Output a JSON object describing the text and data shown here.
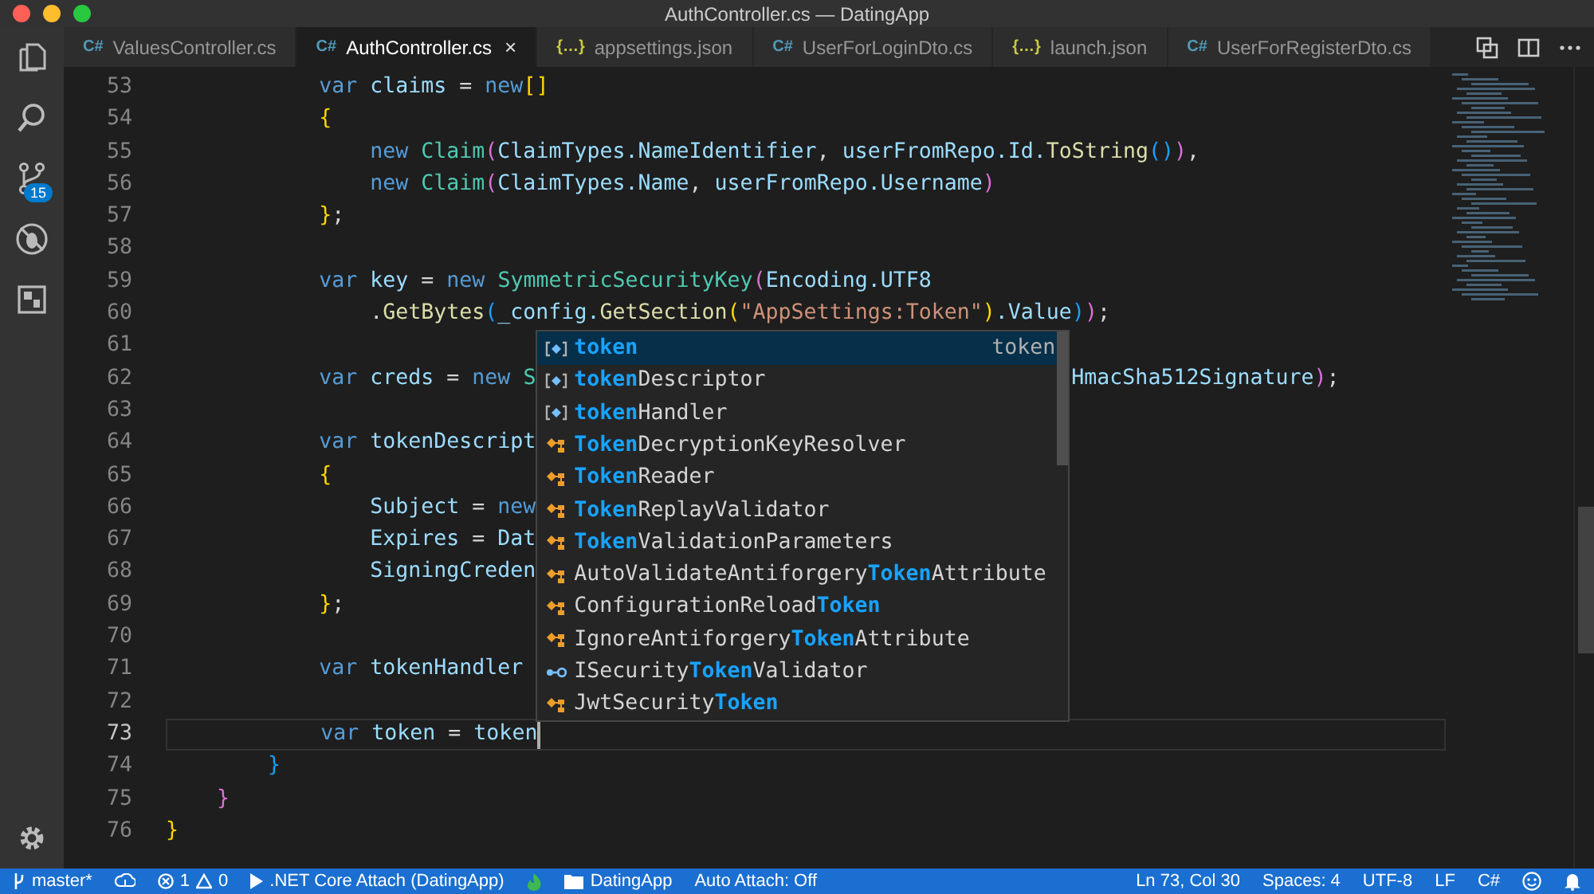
{
  "window": {
    "title": "AuthController.cs — DatingApp"
  },
  "activity_bar": {
    "source_control_badge": "15"
  },
  "tabs": [
    {
      "label": "ValuesController.cs",
      "kind": "csharp",
      "icon": "C#",
      "selected": false
    },
    {
      "label": "AuthController.cs",
      "kind": "csharp",
      "icon": "C#",
      "selected": true,
      "close": "×"
    },
    {
      "label": "appsettings.json",
      "kind": "json",
      "icon": "{…}",
      "selected": false
    },
    {
      "label": "UserForLoginDto.cs",
      "kind": "csharp",
      "icon": "C#",
      "selected": false
    },
    {
      "label": "launch.json",
      "kind": "json",
      "icon": "{…}",
      "selected": false
    },
    {
      "label": "UserForRegisterDto.cs",
      "kind": "csharp",
      "icon": "C#",
      "selected": false
    }
  ],
  "editor": {
    "lines": [
      {
        "number": "53",
        "segments": [
          {
            "text": "            var",
            "kind": "kw"
          },
          {
            "text": " claims",
            "kind": "id"
          },
          {
            "text": " = ",
            "kind": "p"
          },
          {
            "text": "new",
            "kind": "kw"
          },
          {
            "text": "[]",
            "kind": "b1"
          }
        ]
      },
      {
        "number": "54",
        "segments": [
          {
            "text": "            {",
            "kind": "b1"
          }
        ]
      },
      {
        "number": "55",
        "segments": [
          {
            "text": "                new",
            "kind": "kw"
          },
          {
            "text": " Claim",
            "kind": "type"
          },
          {
            "text": "(",
            "kind": "b2"
          },
          {
            "text": "ClaimTypes.NameIdentifier",
            "kind": "id"
          },
          {
            "text": ", ",
            "kind": "p"
          },
          {
            "text": "userFromRepo.Id.",
            "kind": "id"
          },
          {
            "text": "ToString",
            "kind": "fn"
          },
          {
            "text": "()",
            "kind": "b3"
          },
          {
            "text": ")",
            "kind": "b2"
          },
          {
            "text": ",",
            "kind": "p"
          }
        ]
      },
      {
        "number": "56",
        "segments": [
          {
            "text": "                new",
            "kind": "kw"
          },
          {
            "text": " Claim",
            "kind": "type"
          },
          {
            "text": "(",
            "kind": "b2"
          },
          {
            "text": "ClaimTypes.Name",
            "kind": "id"
          },
          {
            "text": ", ",
            "kind": "p"
          },
          {
            "text": "userFromRepo.Username",
            "kind": "id"
          },
          {
            "text": ")",
            "kind": "b2"
          }
        ]
      },
      {
        "number": "57",
        "segments": [
          {
            "text": "            }",
            "kind": "b1"
          },
          {
            "text": ";",
            "kind": "p"
          }
        ]
      },
      {
        "number": "58"
      },
      {
        "number": "59",
        "segments": [
          {
            "text": "            var",
            "kind": "kw"
          },
          {
            "text": " key",
            "kind": "id"
          },
          {
            "text": " = ",
            "kind": "p"
          },
          {
            "text": "new",
            "kind": "kw"
          },
          {
            "text": " SymmetricSecurityKey",
            "kind": "type"
          },
          {
            "text": "(",
            "kind": "b2"
          },
          {
            "text": "Encoding.UTF8",
            "kind": "id"
          }
        ]
      },
      {
        "number": "60",
        "segments": [
          {
            "text": "                .",
            "kind": "p"
          },
          {
            "text": "GetBytes",
            "kind": "fn"
          },
          {
            "text": "(",
            "kind": "b3"
          },
          {
            "text": "_config.",
            "kind": "id"
          },
          {
            "text": "GetSection",
            "kind": "fn"
          },
          {
            "text": "(",
            "kind": "b1"
          },
          {
            "text": "\"AppSettings:Token\"",
            "kind": "str"
          },
          {
            "text": ")",
            "kind": "b1"
          },
          {
            "text": ".Value",
            "kind": "id"
          },
          {
            "text": ")",
            "kind": "b3"
          },
          {
            "text": ")",
            "kind": "b2"
          },
          {
            "text": ";",
            "kind": "p"
          }
        ]
      },
      {
        "number": "61"
      },
      {
        "number": "62",
        "segments": [
          {
            "text": "            var",
            "kind": "kw"
          },
          {
            "text": " creds",
            "kind": "id"
          },
          {
            "text": " = ",
            "kind": "p"
          },
          {
            "text": "new",
            "kind": "kw"
          },
          {
            "text": " S",
            "kind": "type"
          }
        ],
        "trailing": [
          {
            "text": "HmacSha512Signature",
            "kind": "id"
          },
          {
            "text": ")",
            "kind": "b2"
          },
          {
            "text": ";",
            "kind": "p"
          }
        ]
      },
      {
        "number": "63"
      },
      {
        "number": "64",
        "segments": [
          {
            "text": "            var",
            "kind": "kw"
          },
          {
            "text": " tokenDescript",
            "kind": "id"
          }
        ]
      },
      {
        "number": "65",
        "segments": [
          {
            "text": "            {",
            "kind": "b1"
          }
        ]
      },
      {
        "number": "66",
        "segments": [
          {
            "text": "                Subject",
            "kind": "id"
          },
          {
            "text": " = ",
            "kind": "p"
          },
          {
            "text": "new",
            "kind": "kw"
          }
        ]
      },
      {
        "number": "67",
        "segments": [
          {
            "text": "                Expires",
            "kind": "id"
          },
          {
            "text": " = ",
            "kind": "p"
          },
          {
            "text": "Dat",
            "kind": "id"
          }
        ]
      },
      {
        "number": "68",
        "segments": [
          {
            "text": "                SigningCreden",
            "kind": "id"
          }
        ]
      },
      {
        "number": "69",
        "segments": [
          {
            "text": "            }",
            "kind": "b1"
          },
          {
            "text": ";",
            "kind": "p"
          }
        ]
      },
      {
        "number": "70"
      },
      {
        "number": "71",
        "segments": [
          {
            "text": "            var",
            "kind": "kw"
          },
          {
            "text": " tokenHandler",
            "kind": "id"
          }
        ]
      },
      {
        "number": "72"
      },
      {
        "number": "73",
        "current": true,
        "segments": [
          {
            "text": "            var",
            "kind": "kw"
          },
          {
            "text": " token",
            "kind": "id"
          },
          {
            "text": " = ",
            "kind": "p"
          },
          {
            "text": "token",
            "kind": "id"
          }
        ]
      },
      {
        "number": "74",
        "segments": [
          {
            "text": "        }",
            "kind": "b3"
          }
        ]
      },
      {
        "number": "75",
        "segments": [
          {
            "text": "    }",
            "kind": "b2"
          }
        ]
      },
      {
        "number": "76",
        "segments": [
          {
            "text": "}",
            "kind": "b1"
          }
        ]
      }
    ]
  },
  "suggestions": [
    {
      "kind": "variable",
      "parts": [
        {
          "text": "token",
          "match": true
        }
      ],
      "selected": true,
      "detail": "token"
    },
    {
      "kind": "variable",
      "parts": [
        {
          "text": "token",
          "match": true
        },
        {
          "text": "Descriptor",
          "match": false
        }
      ],
      "selected": false
    },
    {
      "kind": "variable",
      "parts": [
        {
          "text": "token",
          "match": true
        },
        {
          "text": "Handler",
          "match": false
        }
      ],
      "selected": false
    },
    {
      "kind": "class",
      "parts": [
        {
          "text": "Token",
          "match": true
        },
        {
          "text": "DecryptionKeyResolver",
          "match": false
        }
      ],
      "selected": false
    },
    {
      "kind": "class",
      "parts": [
        {
          "text": "Token",
          "match": true
        },
        {
          "text": "Reader",
          "match": false
        }
      ],
      "selected": false
    },
    {
      "kind": "class",
      "parts": [
        {
          "text": "Token",
          "match": true
        },
        {
          "text": "ReplayValidator",
          "match": false
        }
      ],
      "selected": false
    },
    {
      "kind": "class",
      "parts": [
        {
          "text": "Token",
          "match": true
        },
        {
          "text": "ValidationParameters",
          "match": false
        }
      ],
      "selected": false
    },
    {
      "kind": "class",
      "parts": [
        {
          "text": "AutoValidateAntiforgery",
          "match": false
        },
        {
          "text": "Token",
          "match": true
        },
        {
          "text": "Attribute",
          "match": false
        }
      ],
      "selected": false
    },
    {
      "kind": "class",
      "parts": [
        {
          "text": "ConfigurationReload",
          "match": false
        },
        {
          "text": "Token",
          "match": true
        }
      ],
      "selected": false
    },
    {
      "kind": "class",
      "parts": [
        {
          "text": "IgnoreAntiforgery",
          "match": false
        },
        {
          "text": "Token",
          "match": true
        },
        {
          "text": "Attribute",
          "match": false
        }
      ],
      "selected": false
    },
    {
      "kind": "interface",
      "parts": [
        {
          "text": "ISecurity",
          "match": false
        },
        {
          "text": "Token",
          "match": true
        },
        {
          "text": "Validator",
          "match": false
        }
      ],
      "selected": false
    },
    {
      "kind": "class",
      "parts": [
        {
          "text": "JwtSecurity",
          "match": false
        },
        {
          "text": "Token",
          "match": true
        }
      ],
      "selected": false
    }
  ],
  "status_bar": {
    "branch": "master*",
    "errors": "1",
    "warnings": "0",
    "debug": ".NET Core Attach (DatingApp)",
    "folder": "DatingApp",
    "auto_attach": "Auto Attach: Off",
    "right": [
      "Ln 73, Col 30",
      "Spaces: 4",
      "UTF-8",
      "LF",
      "C#"
    ]
  }
}
